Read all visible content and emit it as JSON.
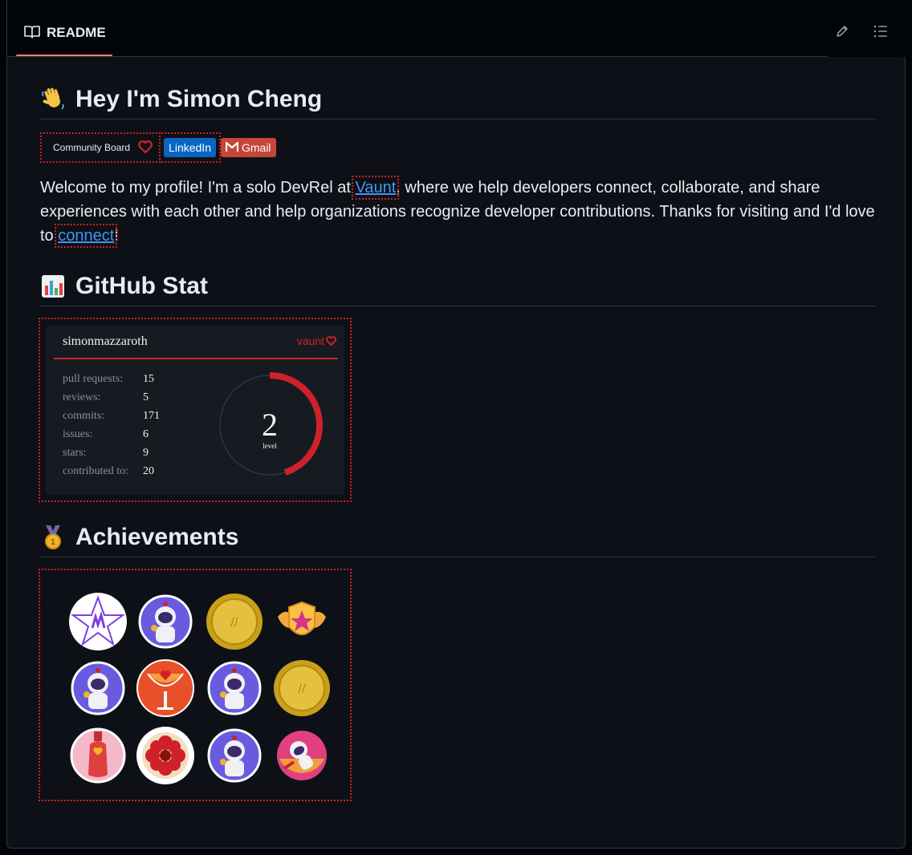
{
  "header": {
    "tab_label": "README",
    "edit_icon": "pencil-icon",
    "toc_icon": "list-unordered-icon"
  },
  "readme": {
    "title": "Hey I'm Simon Cheng",
    "title_emoji": "waving-hand",
    "badges": {
      "community_board": "Community Board",
      "linkedin": "LinkedIn",
      "gmail": "Gmail"
    },
    "intro_before_vaunt": "Welcome to my profile! I'm a solo DevRel at ",
    "vaunt_link": "Vaunt",
    "intro_middle": ", where we help developers connect, collaborate, and share experiences with each other and help organizations recognize developer contributions. Thanks for visiting and I'd love to ",
    "connect_link": "connect",
    "intro_end": "!",
    "stat_heading": "GitHub Stat",
    "achievements_heading": "Achievements"
  },
  "stat_card": {
    "username": "simonmazzaroth",
    "brand": "vaunt",
    "rows": [
      {
        "label": "pull requests:",
        "value": "15"
      },
      {
        "label": "reviews:",
        "value": "5"
      },
      {
        "label": "commits:",
        "value": "171"
      },
      {
        "label": "issues:",
        "value": "6"
      },
      {
        "label": "stars:",
        "value": "9"
      },
      {
        "label": "contributed to:",
        "value": "20"
      }
    ],
    "level": "2",
    "level_label": "level",
    "level_progress": 0.45,
    "accent": "#d0212b"
  },
  "achievements": [
    "vaunt-star",
    "astronaut",
    "gold-coin",
    "star-wings-badge",
    "astronaut",
    "cocktail-glass",
    "astronaut",
    "gold-coin",
    "bottle",
    "red-flower",
    "astronaut",
    "flying-astronaut"
  ]
}
